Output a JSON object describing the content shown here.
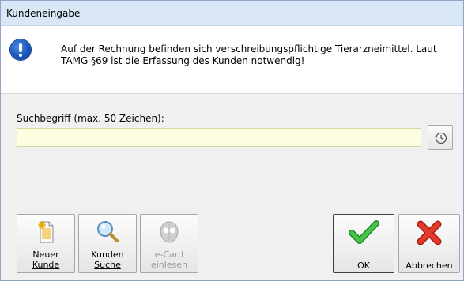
{
  "window": {
    "title": "Kundeneingabe"
  },
  "message": {
    "icon": "info-exclamation-icon",
    "text": "Auf der Rechnung befinden sich verschreibungspflichtige Tierarzneimittel. Laut TAMG §69 ist die Erfassung des Kunden notwendig!"
  },
  "search": {
    "label": "Suchbegriff (max. 50 Zeichen):",
    "value": "",
    "placeholder": "",
    "history_icon": "history-icon"
  },
  "toolbar": {
    "new_customer_line1": "Neuer",
    "new_customer_line2": "Kunde",
    "search_line1": "Kunden",
    "search_line2": "Suche",
    "ecard_line1": "e-Card",
    "ecard_line2": "einlesen",
    "ok": "OK",
    "cancel": "Abbrechen"
  },
  "colors": {
    "titlebar": "#d9e6f5",
    "input_bg": "#fdfde0",
    "ok_green": "#2e9e2e",
    "cancel_red": "#d62b1e"
  }
}
